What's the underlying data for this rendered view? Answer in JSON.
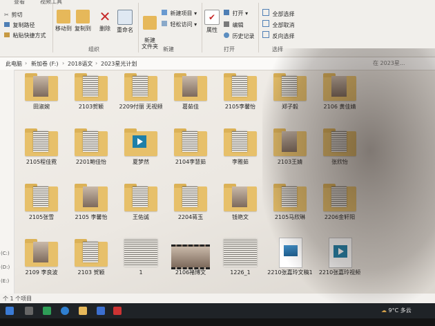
{
  "ribbon": {
    "tab_view": "查看",
    "tab_video": "视频工具",
    "cut": "剪切",
    "copy_path": "复制路径",
    "paste_shortcut": "粘贴快捷方式",
    "move_to": "移动到",
    "copy_to": "复制到",
    "delete": "删除",
    "rename": "重命名",
    "new_folder": "新建\n文件夹",
    "new_item": "新建项目",
    "easy_access": "轻松访问",
    "properties": "属性",
    "open": "打开",
    "edit": "编辑",
    "history": "历史记录",
    "select_all": "全部选择",
    "select_none": "全部取消",
    "invert_selection": "反向选择",
    "group_organize": "组织",
    "group_new": "新建",
    "group_open": "打开",
    "group_select": "选择"
  },
  "address": {
    "crumbs": [
      "此电脑",
      "新加卷 (F:)",
      "2018语文",
      "2023星光计划"
    ],
    "search_placeholder": "在 2023星..."
  },
  "nav": {
    "items": [
      "(C:)",
      "(D:)",
      "(E:)"
    ]
  },
  "files": [
    {
      "name": "田淑婉",
      "kind": "folder"
    },
    {
      "name": "2103贺颖",
      "kind": "folder"
    },
    {
      "name": "2209付丽 无视频",
      "kind": "folder"
    },
    {
      "name": "葛茹佳",
      "kind": "folder"
    },
    {
      "name": "2105李馨怡",
      "kind": "folder"
    },
    {
      "name": "郑子毅",
      "kind": "folder"
    },
    {
      "name": "2106 黄佳婧",
      "kind": "folder"
    },
    {
      "name": "2105程佳霓",
      "kind": "folder"
    },
    {
      "name": "2201鲍佳怡",
      "kind": "folder"
    },
    {
      "name": "夏梦然",
      "kind": "video"
    },
    {
      "name": "2104李慧茹",
      "kind": "folder"
    },
    {
      "name": "李雅茹",
      "kind": "folder"
    },
    {
      "name": "2103王婧",
      "kind": "folder"
    },
    {
      "name": "张欣怡",
      "kind": "folder"
    },
    {
      "name": "2105张雪",
      "kind": "folder"
    },
    {
      "name": "2105 李馨怡",
      "kind": "folder"
    },
    {
      "name": "王佑诚",
      "kind": "folder"
    },
    {
      "name": "2204蒋玉",
      "kind": "folder"
    },
    {
      "name": "钱艳文",
      "kind": "folder"
    },
    {
      "name": "2105马欣琳",
      "kind": "folder"
    },
    {
      "name": "2206金轩阳",
      "kind": "folder"
    },
    {
      "name": "2109 李良波",
      "kind": "folder"
    },
    {
      "name": "2103 贺颖",
      "kind": "folder"
    },
    {
      "name": "1",
      "kind": "image"
    },
    {
      "name": "2106褚博文",
      "kind": "videoframe"
    },
    {
      "name": "1226_1",
      "kind": "image"
    },
    {
      "name": "2210张嘉玲文稿1",
      "kind": "doc"
    },
    {
      "name": "2210张嘉玲视频",
      "kind": "docvideo"
    }
  ],
  "status": {
    "count": "个 1 个项目"
  },
  "taskbar": {
    "weather": "9°C 多云"
  }
}
